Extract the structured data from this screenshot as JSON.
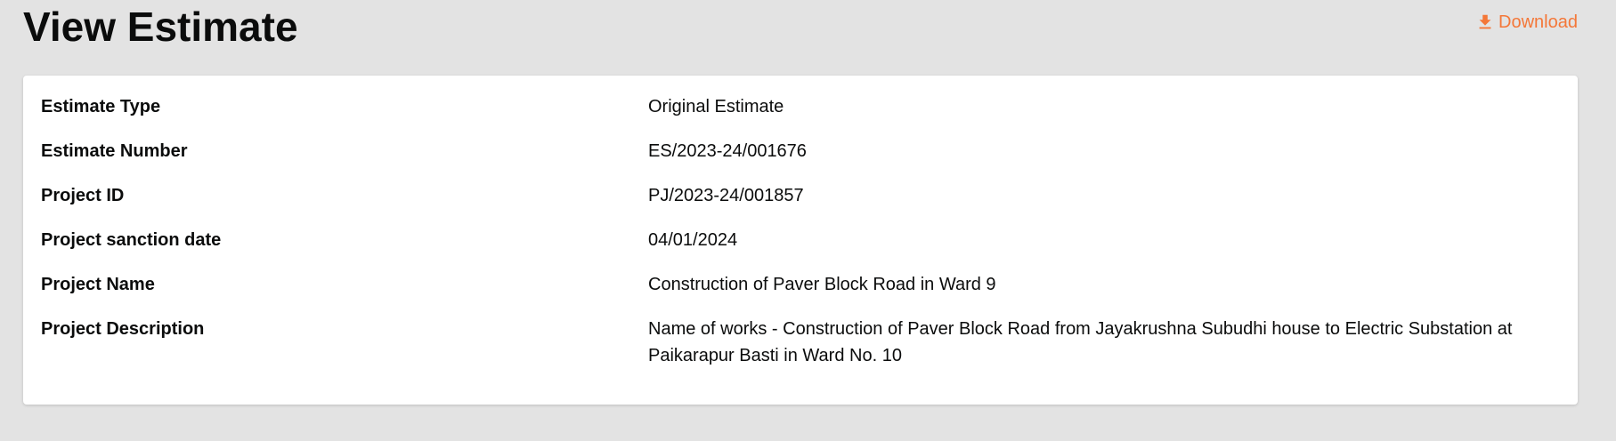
{
  "header": {
    "title": "View Estimate",
    "download_label": "Download",
    "download_icon": "download-icon"
  },
  "colors": {
    "accent": "#f47738",
    "background": "#e3e3e3",
    "card": "#ffffff"
  },
  "details": [
    {
      "label": "Estimate Type",
      "value": "Original Estimate"
    },
    {
      "label": "Estimate Number",
      "value": "ES/2023-24/001676"
    },
    {
      "label": "Project ID",
      "value": "PJ/2023-24/001857"
    },
    {
      "label": "Project sanction date",
      "value": "04/01/2024"
    },
    {
      "label": "Project Name",
      "value": "Construction of Paver Block Road in Ward 9"
    },
    {
      "label": "Project Description",
      "value": "Name of works - Construction of Paver Block Road from Jayakrushna Subudhi house to Electric Substation at Paikarapur Basti in Ward No. 10"
    }
  ]
}
